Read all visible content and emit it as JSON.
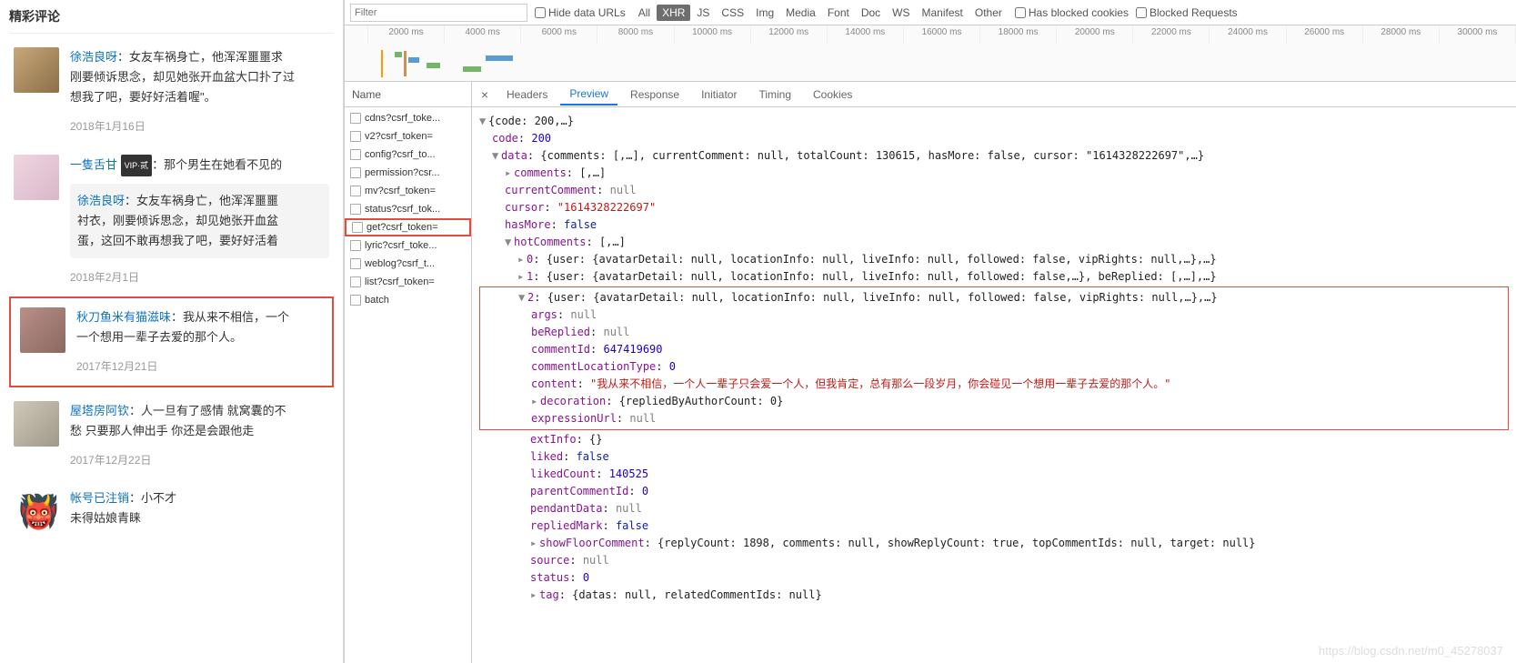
{
  "left": {
    "title": "精彩评论",
    "comments": [
      {
        "user": "徐浩良呀",
        "text": "：女友车祸身亡，他浑浑噩噩求",
        "line2": "刚要倾诉思念，却见她张开血盆大口扑了过",
        "line3": "想我了吧，要好好活着喔\"。",
        "date": "2018年1月16日"
      },
      {
        "user": "一隻舌甘",
        "vip": "VIP·贰",
        "text": "：那个男生在她看不见的",
        "nestedUser": "徐浩良呀",
        "nestedText": "：女友车祸身亡，他浑浑噩噩",
        "nl2": "衬衣，刚要倾诉思念，却见她张开血盆",
        "nl3": "蛋，这回不敢再想我了吧，要好好活着",
        "date": "2018年2月1日"
      },
      {
        "user": "秋刀鱼米有猫滋味",
        "text": "：我从来不相信，一个",
        "line2": "一个想用一辈子去爱的那个人。",
        "date": "2017年12月21日"
      },
      {
        "user": "屋塔房阿钦",
        "text": "：人一旦有了感情 就窝囊的不",
        "line2": "愁 只要那人伸出手 你还是会跟他走",
        "date": "2017年12月22日"
      },
      {
        "user": "帐号已注销",
        "text": "：小不才",
        "line2": "未得姑娘青睐",
        "date": ""
      }
    ]
  },
  "toolbar": {
    "filterPlaceholder": "Filter",
    "hideDataUrls": "Hide data URLs",
    "tabs": [
      "All",
      "XHR",
      "JS",
      "CSS",
      "Img",
      "Media",
      "Font",
      "Doc",
      "WS",
      "Manifest",
      "Other"
    ],
    "blockedCookies": "Has blocked cookies",
    "blockedRequests": "Blocked Requests"
  },
  "timeline": {
    "ticks": [
      "2000 ms",
      "4000 ms",
      "6000 ms",
      "8000 ms",
      "10000 ms",
      "12000 ms",
      "14000 ms",
      "16000 ms",
      "18000 ms",
      "20000 ms",
      "22000 ms",
      "24000 ms",
      "26000 ms",
      "28000 ms",
      "30000 ms"
    ]
  },
  "names": {
    "header": "Name",
    "items": [
      "cdns?csrf_toke...",
      "v2?csrf_token=",
      "config?csrf_to...",
      "permission?csr...",
      "mv?csrf_token=",
      "status?csrf_tok...",
      "get?csrf_token=",
      "lyric?csrf_toke...",
      "weblog?csrf_t...",
      "list?csrf_token=",
      "batch"
    ]
  },
  "detailTabs": [
    "Headers",
    "Preview",
    "Response",
    "Initiator",
    "Timing",
    "Cookies"
  ],
  "json": {
    "root": "{code: 200,…}",
    "code": "200",
    "dataLine": "{comments: [,…], currentComment: null, totalCount: 130615, hasMore: false, cursor: \"1614328222697\",…}",
    "commentsVal": "[,…]",
    "currentComment": "null",
    "cursor": "\"1614328222697\"",
    "hasMore": "false",
    "hotComments": "[,…]",
    "hc0": "{user: {avatarDetail: null, locationInfo: null, liveInfo: null, followed: false, vipRights: null,…},…}",
    "hc1": "{user: {avatarDetail: null, locationInfo: null, liveInfo: null, followed: false,…}, beReplied: [,…],…}",
    "hc2": "{user: {avatarDetail: null, locationInfo: null, liveInfo: null, followed: false, vipRights: null,…},…}",
    "args": "null",
    "beReplied": "null",
    "commentId": "647419690",
    "commentLocationType": "0",
    "content": "\"我从来不相信，一个人一辈子只会爱一个人，但我肯定，总有那么一段岁月，你会碰见一个想用一辈子去爱的那个人。\"",
    "decoration": "{repliedByAuthorCount: 0}",
    "expressionUrl": "null",
    "extInfo": "{}",
    "liked": "false",
    "likedCount": "140525",
    "parentCommentId": "0",
    "pendantData": "null",
    "repliedMark": "false",
    "showFloorComment": "{replyCount: 1898, comments: null, showReplyCount: true, topCommentIds: null, target: null}",
    "source": "null",
    "status": "0",
    "tag": "{datas: null, relatedCommentIds: null}"
  },
  "watermark": "https://blog.csdn.net/m0_45278037"
}
